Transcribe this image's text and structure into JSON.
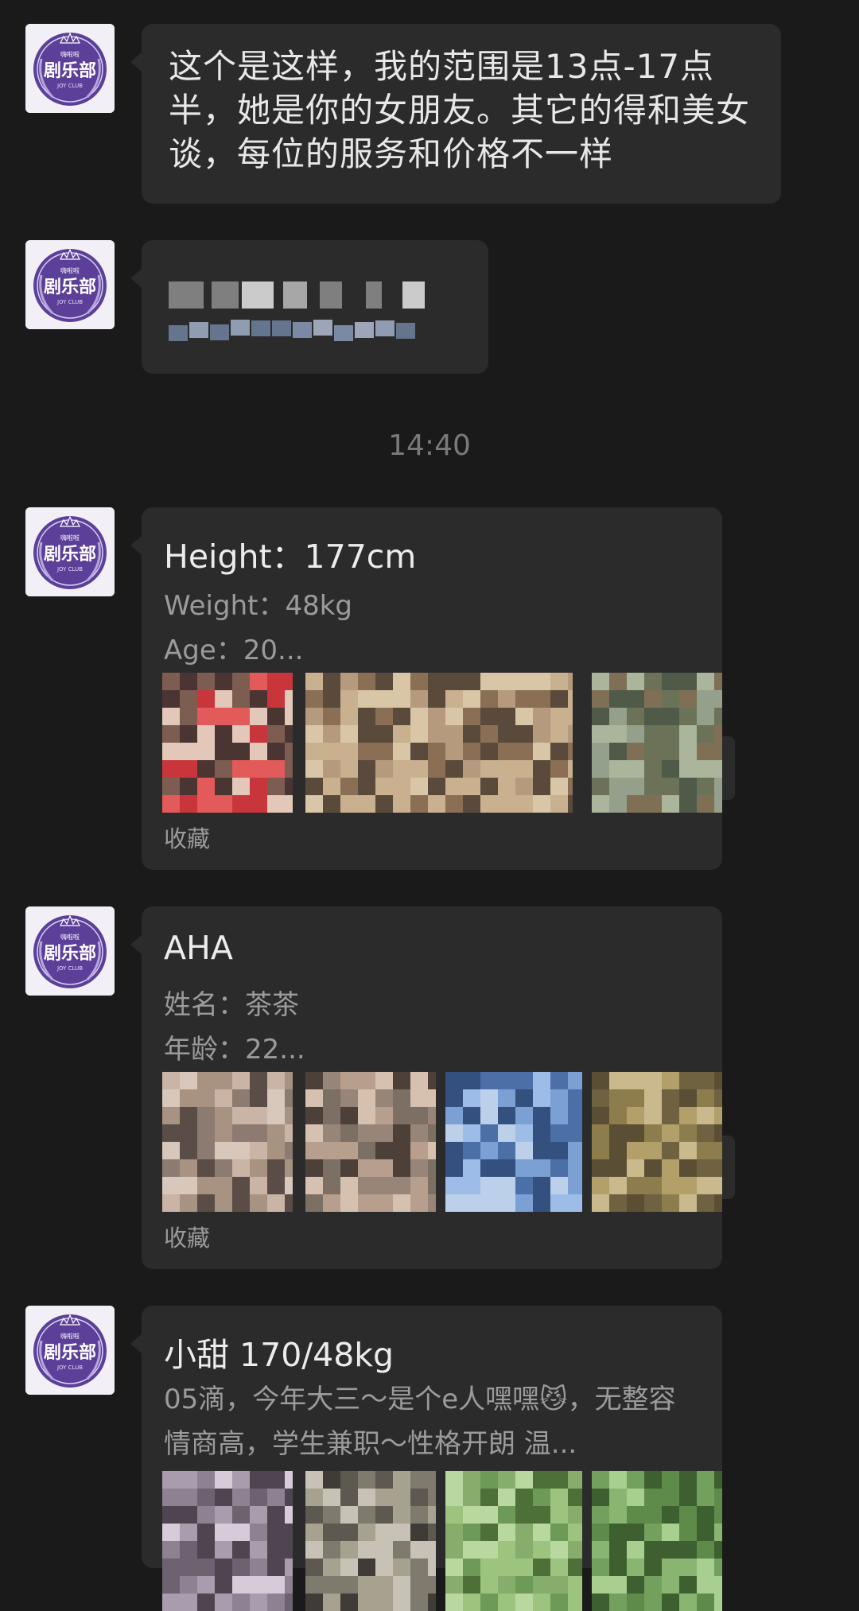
{
  "avatar": {
    "icon": "joy-club-logo-icon",
    "brand_color": "#5b3f98",
    "small_text": "嗨啦啦",
    "main_text": "剧乐部",
    "sub_text": "JOY CLUB"
  },
  "messages": [
    {
      "type": "text",
      "text": "这个是这样，我的范围是13点-17点半，她是你的女朋友。其它的得和美女谈，每位的服务和价格不一样"
    },
    {
      "type": "redacted",
      "note": ""
    }
  ],
  "timestamp": "14:40",
  "cards": [
    {
      "title": "Height：177cm",
      "lines": [
        "Weight：48kg",
        "Age：20..."
      ],
      "footer": "收藏",
      "thumbs": [
        {
          "palette": [
            "#c8363b",
            "#e25a5a",
            "#7d5c52",
            "#e3c7b8",
            "#4a3533"
          ]
        },
        {
          "palette": [
            "#b69a7e",
            "#d9c6a6",
            "#8a6f55",
            "#c9b08f",
            "#5a4a3c"
          ]
        },
        {
          "palette": [
            "#6b7258",
            "#4f5a48",
            "#94a08b",
            "#7f6f55",
            "#aab59b"
          ]
        }
      ]
    },
    {
      "title": "AHA",
      "lines": [
        "姓名：茶茶",
        "年龄：22..."
      ],
      "footer": "收藏",
      "thumbs": [
        {
          "palette": [
            "#8b7b70",
            "#c9b4a5",
            "#5a4d47",
            "#a89383",
            "#d8c7bb"
          ]
        },
        {
          "palette": [
            "#7c6f64",
            "#b89e8c",
            "#4c4038",
            "#d6c1b1",
            "#968578"
          ]
        },
        {
          "palette": [
            "#4d6fa8",
            "#7aa0d4",
            "#9dbde8",
            "#33507f",
            "#bcd0ea"
          ]
        },
        {
          "palette": [
            "#8e7d4c",
            "#b39f69",
            "#6f6240",
            "#cab98c",
            "#5a4e35"
          ]
        }
      ]
    },
    {
      "title": "小甜 170/48kg",
      "desc": "05滴，今年大三～是个e人嘿嘿😼，无整容情商高，学生兼职～性格开朗 温...",
      "thumbs": [
        {
          "palette": [
            "#a89cae",
            "#6c6270",
            "#d7cad9",
            "#4e4550",
            "#8e8191"
          ]
        },
        {
          "palette": [
            "#7e7a6e",
            "#c8c2b6",
            "#5d5850",
            "#a7a190",
            "#3f3c37"
          ]
        },
        {
          "palette": [
            "#6e9a58",
            "#9cc47f",
            "#4d7038",
            "#b8d8a0",
            "#86ad6c"
          ]
        },
        {
          "palette": [
            "#5e8a4a",
            "#8ab571",
            "#3e6030",
            "#a8cf90",
            "#74a05e"
          ]
        }
      ]
    }
  ]
}
